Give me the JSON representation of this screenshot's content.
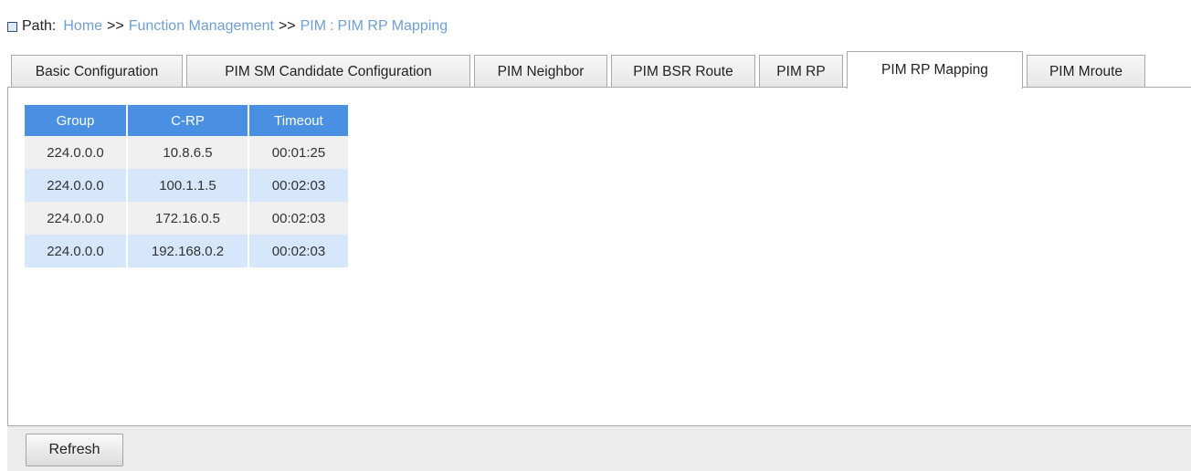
{
  "breadcrumb": {
    "label": "Path:",
    "items": [
      "Home",
      "Function Management",
      "PIM",
      "PIM RP Mapping"
    ],
    "separators": [
      ">>",
      ">>",
      ":"
    ]
  },
  "tabs": [
    {
      "label": "Basic Configuration",
      "active": false
    },
    {
      "label": "PIM SM Candidate Configuration",
      "active": false
    },
    {
      "label": "PIM Neighbor",
      "active": false
    },
    {
      "label": "PIM BSR Route",
      "active": false
    },
    {
      "label": "PIM RP",
      "active": false
    },
    {
      "label": "PIM RP Mapping",
      "active": true
    },
    {
      "label": "PIM Mroute",
      "active": false
    }
  ],
  "table": {
    "columns": [
      "Group",
      "C-RP",
      "Timeout"
    ],
    "rows": [
      [
        "224.0.0.0",
        "10.8.6.5",
        "00:01:25"
      ],
      [
        "224.0.0.0",
        "100.1.1.5",
        "00:02:03"
      ],
      [
        "224.0.0.0",
        "172.16.0.5",
        "00:02:03"
      ],
      [
        "224.0.0.0",
        "192.168.0.2",
        "00:02:03"
      ]
    ]
  },
  "footer": {
    "refresh_label": "Refresh"
  },
  "colors": {
    "header_bg": "#4a90e2",
    "row_odd_bg": "#f0f0f0",
    "row_even_bg": "#d6e6fb",
    "link_color": "#6e9fd4"
  },
  "icons": {
    "path_icon": "square-icon"
  }
}
